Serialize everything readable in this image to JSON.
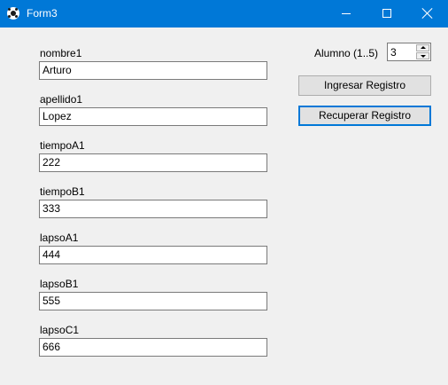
{
  "window": {
    "title": "Form3"
  },
  "fields": [
    {
      "label": "nombre1",
      "value": "Arturo"
    },
    {
      "label": "apellido1",
      "value": "Lopez"
    },
    {
      "label": "tiempoA1",
      "value": "222"
    },
    {
      "label": "tiempoB1",
      "value": "333"
    },
    {
      "label": "lapsoA1",
      "value": "444"
    },
    {
      "label": "lapsoB1",
      "value": "555"
    },
    {
      "label": "lapsoC1",
      "value": "666"
    }
  ],
  "alumno": {
    "label": "Alumno (1..5)",
    "value": "3"
  },
  "buttons": {
    "ingresar": "Ingresar Registro",
    "recuperar": "Recuperar Registro"
  },
  "colors": {
    "titlebar": "#0078d7",
    "focus_border": "#0078d7",
    "window_bg": "#f0f0f0"
  }
}
